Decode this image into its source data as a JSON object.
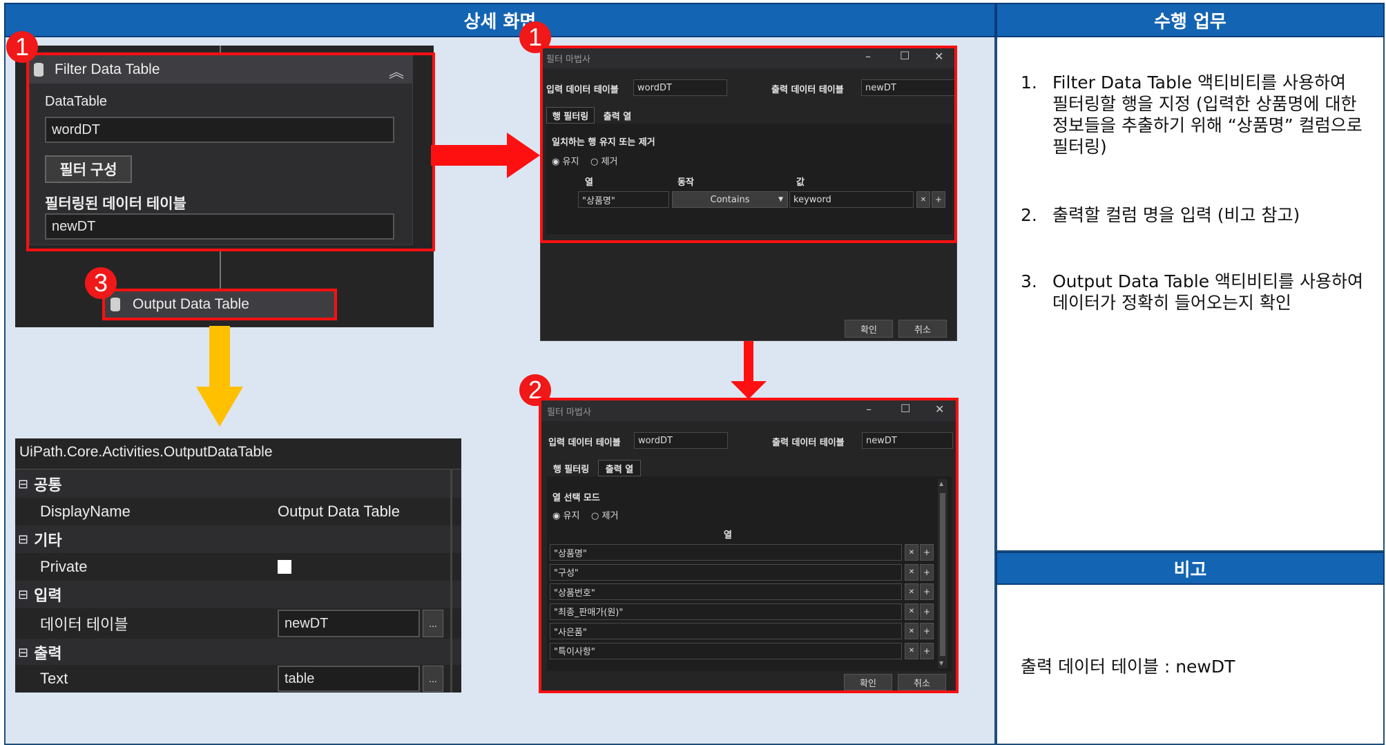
{
  "headers": {
    "detail": "상세 화면",
    "task": "수행 업무",
    "remark": "비고"
  },
  "badges": {
    "b1a": "1",
    "b1b": "1",
    "b2": "2",
    "b3": "3"
  },
  "filter_activity": {
    "title": "Filter Data Table",
    "datatable_label": "DataTable",
    "datatable_value": "wordDT",
    "config_button": "필터 구성",
    "output_label": "필터링된 데이터 테이블",
    "output_value": "newDT"
  },
  "output_activity": {
    "title": "Output Data Table"
  },
  "properties": {
    "title": "UiPath.Core.Activities.OutputDataTable",
    "sections": {
      "common": "공통",
      "misc": "기타",
      "input": "입력",
      "output": "출력"
    },
    "displayname_label": "DisplayName",
    "displayname_value": "Output Data Table",
    "private_label": "Private",
    "datatable_label": "데이터 테이블",
    "datatable_value": "newDT",
    "text_label": "Text",
    "text_value": "table",
    "ellipsis": "..."
  },
  "wizard": {
    "title": "필터 마법사",
    "input_label": "입력 데이터 테이블",
    "input_value": "wordDT",
    "output_label": "출력 데이터 테이블",
    "output_value": "newDT",
    "tab_rows": "행 필터링",
    "tab_cols": "출력 열",
    "ok": "확인",
    "cancel": "취소",
    "minimize": "–",
    "maximize": "☐",
    "close": "✕"
  },
  "wizard1": {
    "mode_label": "일치하는 행 유지 또는 제거",
    "keep": "유지",
    "remove": "제거",
    "col_header": "열",
    "op_header": "동작",
    "val_header": "값",
    "col_value": "\"상품명\"",
    "op_value": "Contains",
    "val_value": "keyword"
  },
  "wizard2": {
    "mode_label": "열 선택 모드",
    "keep": "유지",
    "remove": "제거",
    "col_header": "열",
    "columns": [
      "\"상품명\"",
      "\"구성\"",
      "\"상품번호\"",
      "\"최종_판매가(원)\"",
      "\"사은품\"",
      "\"특이사항\""
    ]
  },
  "tasks": [
    {
      "num": "1.",
      "text": "Filter Data Table 액티비티를 사용하여 필터링할 행을 지정 (입력한 상품명에 대한 정보들을 추출하기 위해 “상품명” 컬럼으로 필터링)"
    },
    {
      "num": "2.",
      "text": "출력할 컬럼 명을 입력 (비고 참고)"
    },
    {
      "num": "3.",
      "text": "Output Data Table 액티비티를 사용하여 데이터가 정확히 들어오는지 확인"
    }
  ],
  "remark_text": "출력 데이터 테이블 : newDT",
  "colors": {
    "header": "#1464b4",
    "panel": "#dce6f2",
    "highlight": "#ff1010",
    "arrow_yellow": "#ffc000",
    "dark_ui": "#2d2d30"
  }
}
